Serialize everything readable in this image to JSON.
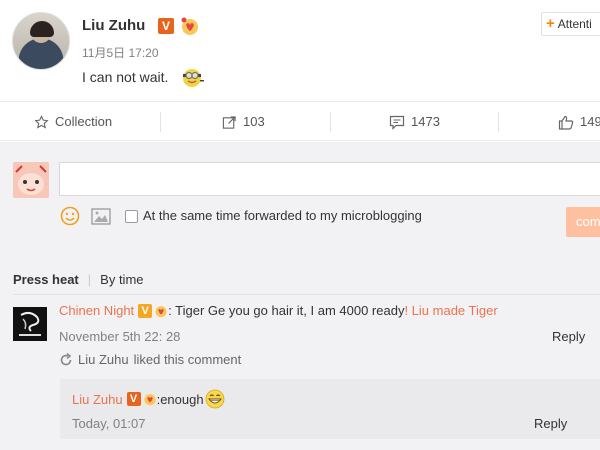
{
  "post": {
    "username": "Liu Zuhu",
    "verified_badge": "V",
    "timestamp": "11月5日 17:20",
    "text": "I can not wait.",
    "follow_label": "Attenti"
  },
  "actions": {
    "collection": "Collection",
    "forward_count": "103",
    "comment_count": "1473",
    "like_count": "149"
  },
  "composer": {
    "forward_option": "At the same time forwarded to my microblogging",
    "submit_label": "com"
  },
  "sort": {
    "hot": "Press heat",
    "time": "By time"
  },
  "comment": {
    "author": "Chinen Night",
    "text": ": Tiger Ge you go hair it, I am 4000 ready ",
    "link_text": "! Liu made Tiger",
    "date": "November 5th 22: 28",
    "reply_label": "Reply",
    "liked_by": "Liu Zuhu",
    "liked_text": "liked  this comment"
  },
  "reply": {
    "author": "Liu Zuhu",
    "text": ":enough",
    "date": "Today, 01:07",
    "reply_label": "Reply"
  },
  "colors": {
    "accent_orange": "#eb7350",
    "follow_plus": "#ff8200",
    "verified": "#e8641c",
    "submit_disabled": "#ffc09f",
    "comment_bg": "#f2f2f5"
  }
}
